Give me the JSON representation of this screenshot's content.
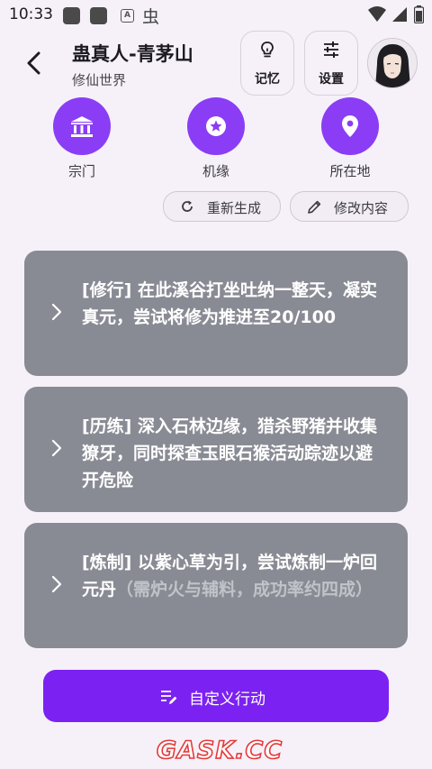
{
  "status_bar": {
    "time": "10:33",
    "icons": [
      "notification-square-icon",
      "notification-square-icon",
      "a-box-icon",
      "bug-icon",
      "wifi-icon",
      "signal-icon",
      "battery-icon"
    ]
  },
  "header": {
    "title": "蛊真人-青茅山",
    "subtitle": "修仙世界",
    "memory_label": "记忆",
    "settings_label": "设置"
  },
  "categories": [
    {
      "label": "宗门",
      "icon": "bank-icon"
    },
    {
      "label": "机缘",
      "icon": "star-badge-icon"
    },
    {
      "label": "所在地",
      "icon": "location-pin-icon"
    }
  ],
  "actions": {
    "regenerate_label": "重新生成",
    "edit_label": "修改内容"
  },
  "options": [
    {
      "text": "[修行] 在此溪谷打坐吐纳一整天，凝实真元，尝试将修为推进至20/100",
      "note": ""
    },
    {
      "text": "[历练] 深入石林边缘，猎杀野猪并收集獠牙，同时探查玉眼石猴活动踪迹以避开危险",
      "note": ""
    },
    {
      "text": "[炼制] 以紫心草为引，尝试炼制一炉回元丹",
      "note": "（需炉火与辅料，成功率约四成）"
    }
  ],
  "cta": {
    "label": "自定义行动"
  },
  "watermark": "GASK.CC",
  "colors": {
    "accent": "#7B22F2",
    "category_circle": "#8A3DF5",
    "card_bg": "#898B94",
    "page_bg": "#F6F1F9",
    "watermark_red": "#E63A3A"
  }
}
